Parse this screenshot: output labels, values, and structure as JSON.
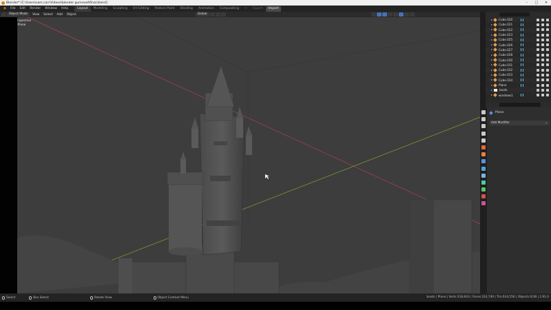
{
  "window": {
    "title": "Blender* [C:\\Users\\sam.carr\\Videos\\blender gumroad\\final.blend]",
    "controls": [
      "–",
      "□",
      "✕"
    ]
  },
  "menu": [
    "File",
    "Edit",
    "Render",
    "Window",
    "Help"
  ],
  "workspaces": [
    {
      "label": "Layout",
      "state": "active"
    },
    {
      "label": "Modeling",
      "state": ""
    },
    {
      "label": "Sculpting",
      "state": ""
    },
    {
      "label": "UV Editing",
      "state": ""
    },
    {
      "label": "Texture Paint",
      "state": ""
    },
    {
      "label": "Shading",
      "state": ""
    },
    {
      "label": "Animation",
      "state": ""
    },
    {
      "label": "Compositing",
      "state": ""
    },
    {
      "label": "+",
      "state": "dim"
    },
    {
      "label": "Export",
      "state": "dim"
    },
    {
      "label": "Import",
      "state": "hl"
    }
  ],
  "scene": {
    "label": "Scene",
    "view_layer": "View Layer"
  },
  "viewport_header": {
    "mode": "Object Mode",
    "menus": [
      "View",
      "Select",
      "Add",
      "Object"
    ],
    "orientation": "Global"
  },
  "viewport": {
    "view_name": "Camera Perspective",
    "context": "(2) boots | Plane"
  },
  "outliner": {
    "rows": [
      {
        "label": "Cube.020",
        "type": "mesh"
      },
      {
        "label": "Cube.021",
        "type": "mesh"
      },
      {
        "label": "Cube.022",
        "type": "mesh"
      },
      {
        "label": "Cube.023",
        "type": "mesh"
      },
      {
        "label": "Cube.025",
        "type": "mesh"
      },
      {
        "label": "Cube.026",
        "type": "mesh"
      },
      {
        "label": "Cube.027",
        "type": "mesh"
      },
      {
        "label": "Cube.028",
        "type": "mesh"
      },
      {
        "label": "Cube.030",
        "type": "mesh"
      },
      {
        "label": "Cube.031",
        "type": "mesh"
      },
      {
        "label": "Cube.032",
        "type": "mesh"
      },
      {
        "label": "Cube.033",
        "type": "mesh"
      },
      {
        "label": "Cube.034",
        "type": "mesh"
      },
      {
        "label": "Plane",
        "type": "mesh"
      },
      {
        "label": "boots",
        "type": "collection"
      },
      {
        "label": "windows1",
        "type": "mesh"
      }
    ]
  },
  "properties": {
    "object_name": "Plane",
    "add_modifier": "Add Modifier",
    "tab_colors": [
      "#c9c9c9",
      "#c9c9c9",
      "#c9c9c9",
      "#c9c9c9",
      "#c9c9c9",
      "#e06a36",
      "#e0823c",
      "#5a93e0",
      "#4fa3d9",
      "#7fb0e0",
      "#4ec9a2",
      "#56c56a",
      "#d94e4e",
      "#c55a8a"
    ]
  },
  "status": {
    "select": "Select",
    "box_select": "Box Select",
    "rotate": "Rotate View",
    "context_menu": "Object Context Menu",
    "stats": "boots | Plane | Verts:318,643 | Faces:314,749 | Tris:634,556 | Objects:0/38 | 2.91.0"
  },
  "colors": {
    "accent": "#e87d0d",
    "active_blue": "#4772b3",
    "x_axis": "#c04050",
    "y_axis": "#8aa030"
  }
}
